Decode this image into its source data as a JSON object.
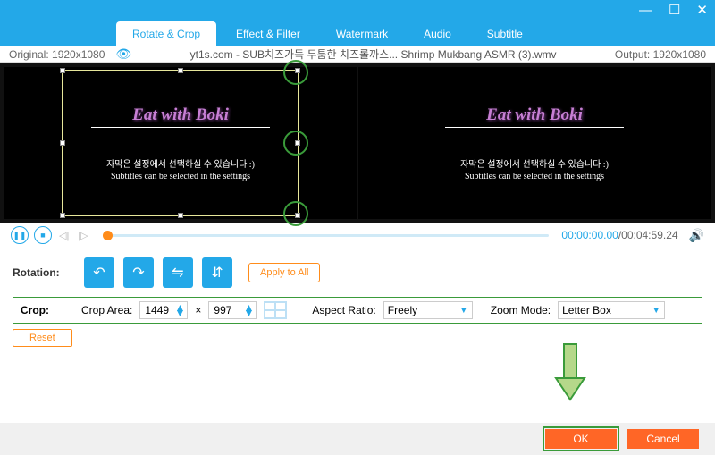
{
  "titlebar": {
    "minimize": "—",
    "maximize": "☐",
    "close": "✕"
  },
  "tabs": {
    "t0": "Rotate & Crop",
    "t1": "Effect & Filter",
    "t2": "Watermark",
    "t3": "Audio",
    "t4": "Subtitle"
  },
  "info": {
    "original": "Original: 1920x1080",
    "filename": "yt1s.com - SUB치즈가득 두툼한 치즈롤까스... Shrimp Mukbang ASMR (3).wmv",
    "output": "Output: 1920x1080"
  },
  "overlay": {
    "title": "Eat with Boki",
    "line1": "자막은 설정에서 선택하실 수 있습니다 :)",
    "line2": "Subtitles can be selected in the settings"
  },
  "play": {
    "cur": "00:00:00.00",
    "sep": "/",
    "tot": "00:04:59.24"
  },
  "rotation": {
    "label": "Rotation:",
    "apply": "Apply to All"
  },
  "crop": {
    "label": "Crop:",
    "area": "Crop Area:",
    "w": "1449",
    "x": "×",
    "h": "997",
    "ratio_label": "Aspect Ratio:",
    "ratio_val": "Freely",
    "zoom_label": "Zoom Mode:",
    "zoom_val": "Letter Box",
    "reset": "Reset"
  },
  "footer": {
    "ok": "OK",
    "cancel": "Cancel"
  }
}
